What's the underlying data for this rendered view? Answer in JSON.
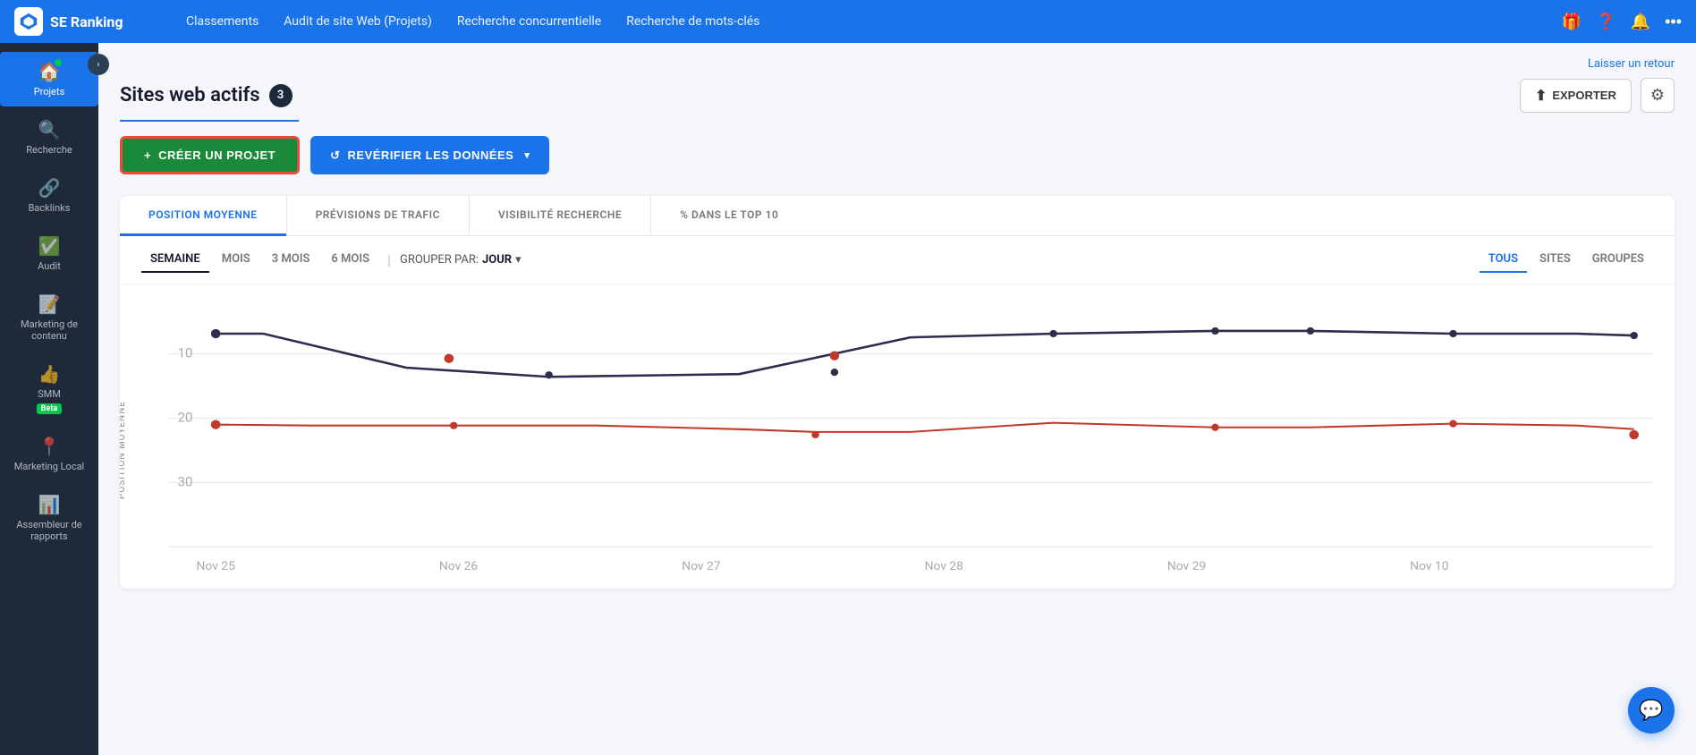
{
  "app": {
    "name": "SE Ranking"
  },
  "topnav": {
    "links": [
      {
        "id": "classements",
        "label": "Classements"
      },
      {
        "id": "audit",
        "label": "Audit de site Web (Projets)"
      },
      {
        "id": "recherche-conc",
        "label": "Recherche concurrentielle"
      },
      {
        "id": "recherche-mots",
        "label": "Recherche de mots-clés"
      }
    ]
  },
  "sidebar": {
    "items": [
      {
        "id": "projets",
        "label": "Projets",
        "icon": "🏠",
        "active": true
      },
      {
        "id": "recherche",
        "label": "Recherche",
        "icon": "🔍",
        "active": false
      },
      {
        "id": "backlinks",
        "label": "Backlinks",
        "icon": "🔗",
        "active": false
      },
      {
        "id": "audit",
        "label": "Audit",
        "icon": "✅",
        "active": false
      },
      {
        "id": "marketing-contenu",
        "label": "Marketing de contenu",
        "icon": "📝",
        "active": false
      },
      {
        "id": "smm",
        "label": "SMM",
        "icon": "👍",
        "active": false,
        "badge": "Beta"
      },
      {
        "id": "marketing-local",
        "label": "Marketing Local",
        "icon": "📍",
        "active": false
      },
      {
        "id": "assembleur",
        "label": "Assembleur de rapports",
        "icon": "📊",
        "active": false
      }
    ]
  },
  "feedback": {
    "label": "Laisser un retour"
  },
  "page": {
    "title": "Sites web actifs",
    "count": "3",
    "export_label": "EXPORTER"
  },
  "buttons": {
    "create_label": "+ CRÉER UN PROJET",
    "recheck_label": "↺  REVÉRIFIER LES DONNÉES"
  },
  "chart": {
    "metric_tabs": [
      {
        "id": "position-moyenne",
        "label": "POSITION MOYENNE",
        "active": true
      },
      {
        "id": "previsions-trafic",
        "label": "PRÉVISIONS DE TRAFIC",
        "active": false
      },
      {
        "id": "visibilite-recherche",
        "label": "VISIBILITÉ RECHERCHE",
        "active": false
      },
      {
        "id": "top10",
        "label": "% DANS LE TOP 10",
        "active": false
      }
    ],
    "time_tabs": [
      {
        "id": "semaine",
        "label": "SEMAINE",
        "active": true
      },
      {
        "id": "mois",
        "label": "MOIS",
        "active": false
      },
      {
        "id": "3mois",
        "label": "3 MOIS",
        "active": false
      },
      {
        "id": "6mois",
        "label": "6 MOIS",
        "active": false
      }
    ],
    "group_by_label": "GROUPER PAR:",
    "group_by_value": "JOUR",
    "view_tabs": [
      {
        "id": "tous",
        "label": "TOUS",
        "active": true
      },
      {
        "id": "sites",
        "label": "SITES",
        "active": false
      },
      {
        "id": "groupes",
        "label": "GROUPES",
        "active": false
      }
    ],
    "y_axis_label": "POSITION MOYENNE",
    "y_axis_values": [
      "10",
      "20",
      "30"
    ],
    "x_axis_labels": [
      "Nov 25",
      "Nov 26",
      "Nov 27",
      "Nov 28",
      "Nov 29",
      "Nov 10"
    ],
    "line1_color": "#2d2d4e",
    "line2_color": "#c0392b"
  }
}
